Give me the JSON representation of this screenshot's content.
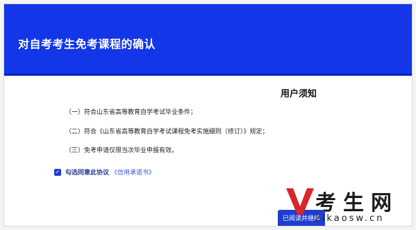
{
  "header": {
    "title": "对自考考生免考课程的确认"
  },
  "notice": {
    "title": "用户须知",
    "items": [
      "（一）符合山东省高等教育自学考试毕业条件；",
      "（二）符合《山东省高等教育自学考试课程免考实施细则（修订）》规定；",
      "（三）免考申请仅限当次毕业申报有效。"
    ]
  },
  "agreement": {
    "checked": true,
    "label": "勾选同意此协议",
    "link": "《信用承诺书》"
  },
  "submit": {
    "label": "已阅读并继续"
  },
  "watermark": {
    "text": "考生网",
    "url": "zikaosw.cn"
  },
  "colors": {
    "header": "#1236e8",
    "button": "#1f3ed0",
    "watermark_mark": "#d9252b"
  }
}
